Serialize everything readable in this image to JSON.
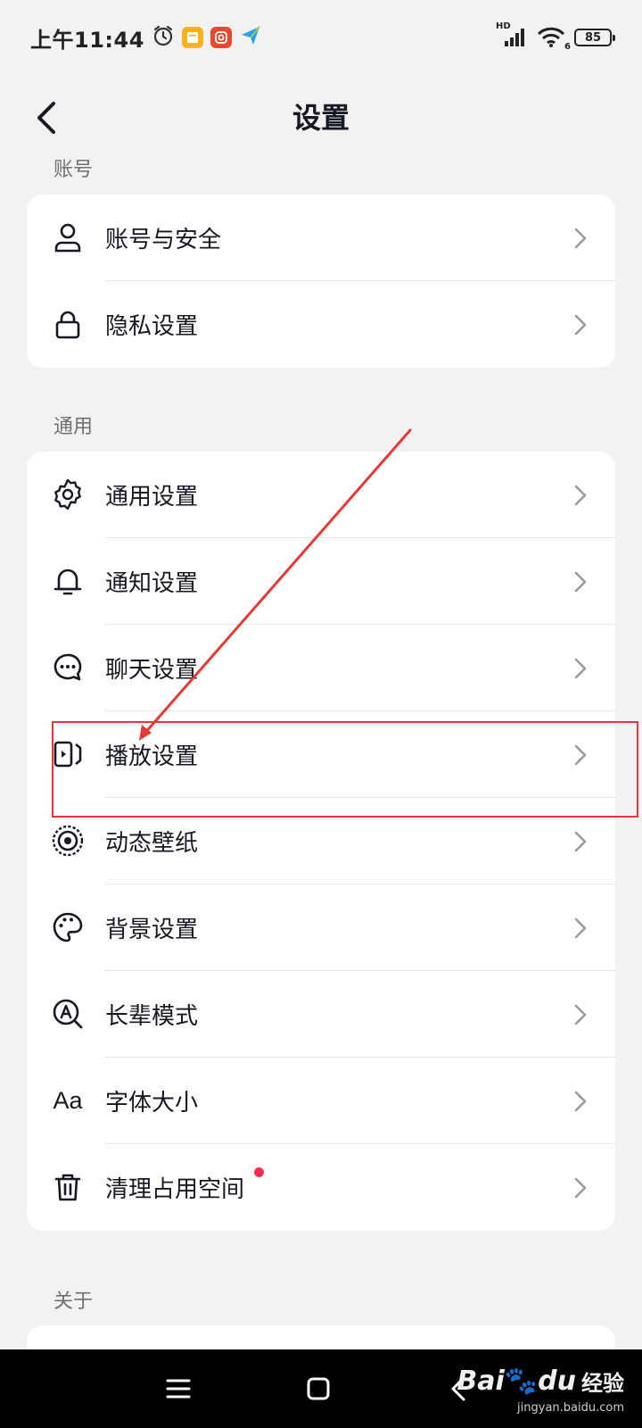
{
  "status_bar": {
    "time": "上午11:44",
    "network": "HD",
    "wifi_badge": "6",
    "battery": "85",
    "icons": [
      "alarm-icon",
      "notes-app-icon",
      "camera-app-icon",
      "paper-plane-app-icon",
      "signal-icon",
      "wifi-icon",
      "battery-icon"
    ]
  },
  "header": {
    "title": "设置",
    "back_icon": "back-arrow-icon"
  },
  "sections": [
    {
      "label": "账号",
      "items": [
        {
          "label": "账号与安全",
          "icon": "user-icon"
        },
        {
          "label": "隐私设置",
          "icon": "lock-icon"
        }
      ]
    },
    {
      "label": "通用",
      "items": [
        {
          "label": "通用设置",
          "icon": "gear-icon"
        },
        {
          "label": "通知设置",
          "icon": "bell-icon"
        },
        {
          "label": "聊天设置",
          "icon": "chat-bubble-icon"
        },
        {
          "label": "播放设置",
          "icon": "playback-icon"
        },
        {
          "label": "动态壁纸",
          "icon": "dynamic-wallpaper-icon"
        },
        {
          "label": "背景设置",
          "icon": "palette-icon"
        },
        {
          "label": "长辈模式",
          "icon": "elder-mode-icon"
        },
        {
          "label": "字体大小",
          "icon": "font-size-icon",
          "icon_text": "Aa"
        },
        {
          "label": "清理占用空间",
          "icon": "trash-icon",
          "badge": "red-dot"
        }
      ]
    },
    {
      "label": "关于",
      "items": []
    }
  ],
  "annotation": {
    "color": "#e53935",
    "highlighted_item": "播放设置"
  },
  "system_nav": {
    "buttons": [
      "menu-icon",
      "home-icon",
      "back-icon"
    ]
  },
  "watermark": {
    "brand": "Bai",
    "brand_suffix": "du",
    "cn": "经验",
    "url": "jingyan.baidu.com"
  },
  "colors": {
    "page_bg": "#f2f2f2",
    "card_bg": "#ffffff",
    "text": "#161823",
    "section_label": "#707070",
    "badge": "#fe2c55"
  }
}
